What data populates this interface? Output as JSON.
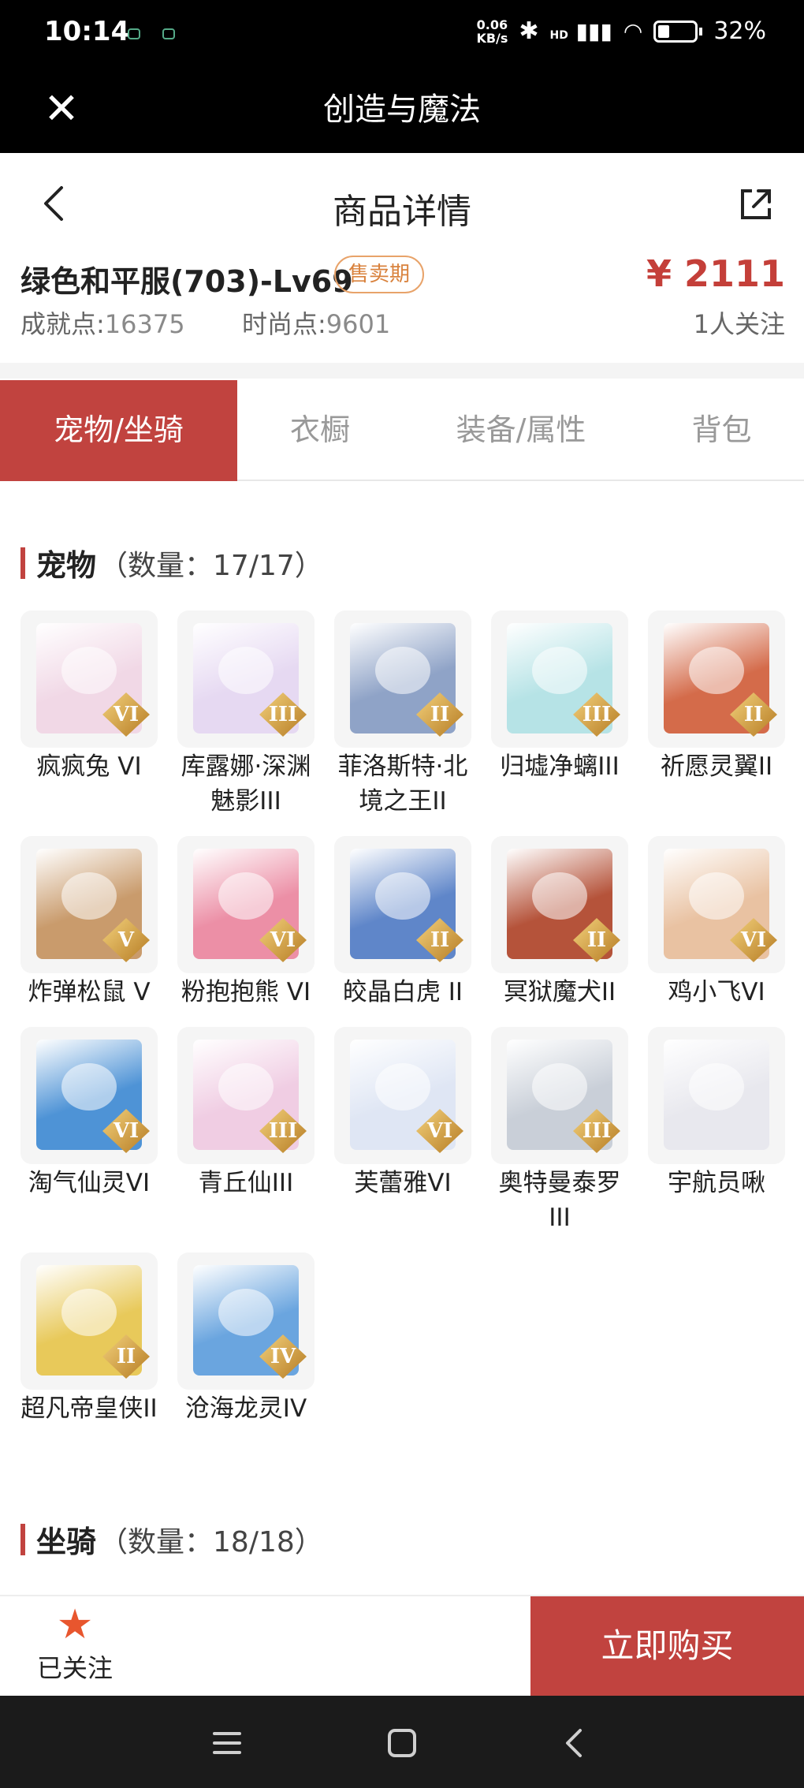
{
  "status_bar": {
    "time": "10:14",
    "speed": "0.06\nKB/s",
    "signal_label": "HD",
    "battery": "32%"
  },
  "header": {
    "title": "创造与魔法",
    "close_icon": "close-icon"
  },
  "nav": {
    "title": "商品详情",
    "back_icon": "chevron-left-icon",
    "share_icon": "share-icon"
  },
  "product": {
    "name": "绿色和平服(703)-Lv69",
    "badge": "售卖期",
    "price": "¥ 2111",
    "achievement_label": "成就点:",
    "achievement_value": "16375",
    "fashion_label": "时尚点:",
    "fashion_value": "9601",
    "followers": "1人关注"
  },
  "tabs": [
    {
      "label": "宠物/坐骑",
      "active": true
    },
    {
      "label": "衣橱",
      "active": false
    },
    {
      "label": "装备/属性",
      "active": false
    },
    {
      "label": "背包",
      "active": false
    }
  ],
  "pets_section": {
    "title": "宠物",
    "count": "（数量：17/17）"
  },
  "pets": [
    {
      "name": "疯疯兔 VI",
      "rank": "VI",
      "color": "#f1d8e6"
    },
    {
      "name": "库露娜·深渊魅影III",
      "rank": "III",
      "color": "#e6d9f2"
    },
    {
      "name": "菲洛斯特·北境之王II",
      "rank": "II",
      "color": "#8fa3c7"
    },
    {
      "name": "归墟净螭III",
      "rank": "III",
      "color": "#b6e3e6"
    },
    {
      "name": "祈愿灵翼II",
      "rank": "II",
      "color": "#d46b4a"
    },
    {
      "name": "炸弹松鼠 V",
      "rank": "V",
      "color": "#c99b6c"
    },
    {
      "name": "粉抱抱熊 VI",
      "rank": "VI",
      "color": "#ec8fa6"
    },
    {
      "name": "皎晶白虎 II",
      "rank": "II",
      "color": "#5f86c9"
    },
    {
      "name": "冥狱魔犬II",
      "rank": "II",
      "color": "#b5533a"
    },
    {
      "name": "鸡小飞VI",
      "rank": "VI",
      "color": "#e9c2a2"
    },
    {
      "name": "淘气仙灵VI",
      "rank": "VI",
      "color": "#4e93d6"
    },
    {
      "name": "青丘仙III",
      "rank": "III",
      "color": "#f0cde3"
    },
    {
      "name": "芙蕾雅VI",
      "rank": "VI",
      "color": "#dfe6f4"
    },
    {
      "name": "奥特曼泰罗III",
      "rank": "III",
      "color": "#c9cfd8"
    },
    {
      "name": "宇航员啾",
      "rank": "",
      "color": "#e8e8ee"
    },
    {
      "name": "超凡帝皇侠II",
      "rank": "II",
      "color": "#e8c95a"
    },
    {
      "name": "沧海龙灵IV",
      "rank": "IV",
      "color": "#6aa5df"
    }
  ],
  "mounts_section": {
    "title": "坐骑",
    "count": "（数量：18/18）"
  },
  "bottom": {
    "follow_label": "已关注",
    "follow_icon": "star-icon",
    "buy_label": "立即购买"
  },
  "system_nav": {
    "menu_icon": "menu-icon",
    "home_icon": "home-icon",
    "back_icon": "back-icon"
  }
}
